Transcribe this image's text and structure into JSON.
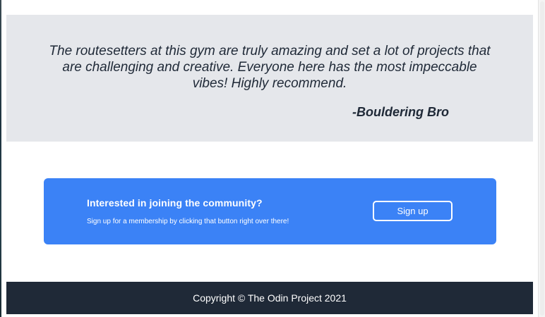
{
  "testimonial": {
    "quote": "The routesetters at this gym are truly amazing and set a lot of projects that are challenging and creative. Everyone here has the most impeccable vibes! Highly recommend.",
    "author": "-Bouldering Bro"
  },
  "cta": {
    "heading": "Interested in joining the community?",
    "text": "Sign up for a membership by clicking that button right over there!",
    "button_label": "Sign up"
  },
  "footer": {
    "copyright": "Copyright © The Odin Project 2021"
  },
  "colors": {
    "testimonial_bg": "#e5e7eb",
    "text_dark": "#1f2937",
    "cta_bg": "#3b82f6",
    "footer_bg": "#1f2937",
    "white": "#ffffff"
  }
}
